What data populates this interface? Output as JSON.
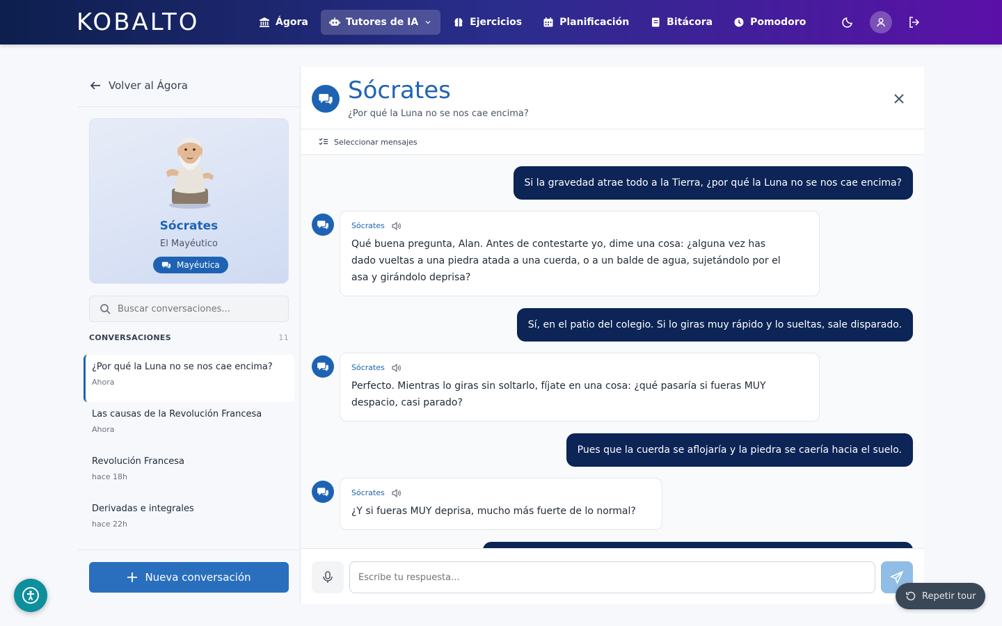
{
  "app": {
    "logo": "KOBALTO"
  },
  "nav": {
    "items": [
      {
        "label": "Ágora",
        "icon": "bank-icon",
        "active": false
      },
      {
        "label": "Tutores de IA",
        "icon": "robot-icon",
        "active": true
      },
      {
        "label": "Ejercicios",
        "icon": "brain-icon",
        "active": false
      },
      {
        "label": "Planificación",
        "icon": "calendar-icon",
        "active": false
      },
      {
        "label": "Bitácora",
        "icon": "notebook-icon",
        "active": false
      },
      {
        "label": "Pomodoro",
        "icon": "clock-icon",
        "active": false
      }
    ]
  },
  "sidebar": {
    "back_label": "Volver al Ágora",
    "tutor": {
      "name": "Sócrates",
      "subtitle": "El Mayéutico",
      "badge": "Mayéutica"
    },
    "search_placeholder": "Buscar conversaciones...",
    "conversations_header": "CONVERSACIONES",
    "conversations_count": "11",
    "conversations": [
      {
        "title": "¿Por qué la Luna no se nos cae encima?",
        "time": "Ahora",
        "active": true
      },
      {
        "title": "Las causas de la Revolución Francesa",
        "time": "Ahora",
        "active": false
      },
      {
        "title": "Revolución Francesa",
        "time": "hace 18h",
        "active": false
      },
      {
        "title": "Derivadas e integrales",
        "time": "hace 22h",
        "active": false
      }
    ],
    "new_conversation_label": "Nueva conversación"
  },
  "chat": {
    "title": "Sócrates",
    "subtitle": "¿Por qué la Luna no se nos cae encima?",
    "select_messages_label": "Seleccionar mensajes",
    "messages": [
      {
        "role": "user",
        "text": "Si la gravedad atrae todo a la Tierra, ¿por qué la Luna no se nos cae encima?"
      },
      {
        "role": "bot",
        "author": "Sócrates",
        "lines": [
          "Qué buena pregunta, Alan. Antes de contestarte yo, dime una cosa: ¿alguna vez has",
          "dado vueltas a una piedra atada a una cuerda, o a un balde de agua, sujetándolo por el",
          "asa y girándolo deprisa?"
        ]
      },
      {
        "role": "user",
        "text": "Sí, en el patio del colegio. Si lo giras muy rápido y lo sueltas, sale disparado."
      },
      {
        "role": "bot",
        "author": "Sócrates",
        "lines": [
          "Perfecto. Mientras lo giras sin soltarlo, fíjate en una cosa: ¿qué pasaría si fueras MUY",
          "despacio, casi parado?"
        ]
      },
      {
        "role": "user",
        "text": "Pues que la cuerda se aflojaría y la piedra se caería hacia el suelo."
      },
      {
        "role": "bot",
        "author": "Sócrates",
        "lines": [
          "¿Y si fueras MUY deprisa, mucho más fuerte de lo normal?"
        ]
      }
    ],
    "input_placeholder": "Escribe tu respuesta..."
  },
  "floating": {
    "tour_label": "Repetir tour"
  },
  "colors": {
    "accent": "#1e63b3",
    "user_bubble": "#0c2456",
    "nav_start": "#0d1f4d",
    "nav_end": "#5b10a8"
  }
}
